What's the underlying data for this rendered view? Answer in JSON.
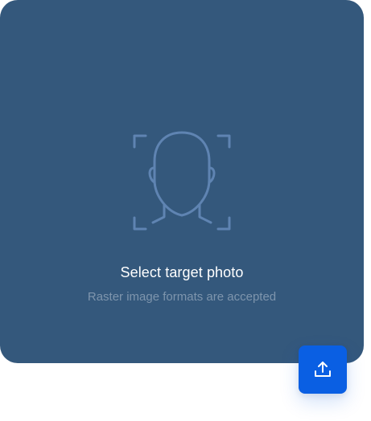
{
  "upload_card": {
    "icon": "face-scan-icon",
    "title": "Select target photo",
    "subtitle": "Raster image formats are accepted"
  },
  "upload_button": {
    "icon": "upload-icon"
  },
  "colors": {
    "card_background": "#34587c",
    "icon_stroke": "#5f84b2",
    "title_text": "#ffffff",
    "subtitle_text": "#7e95ad",
    "button_background": "#0a5fe3",
    "button_icon": "#ffffff"
  }
}
